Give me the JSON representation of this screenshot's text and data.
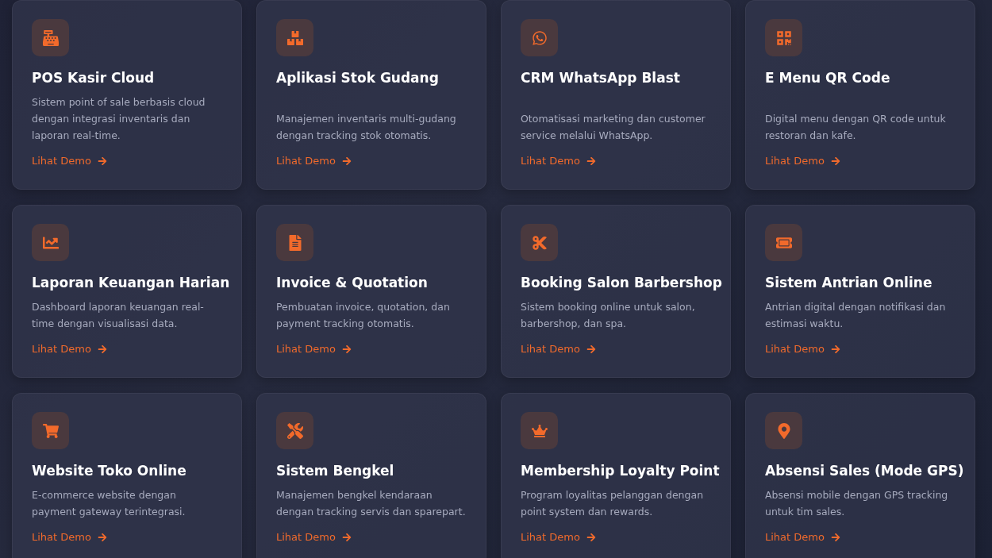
{
  "cards": [
    {
      "title": "POS Kasir Cloud",
      "description": "Sistem point of sale berbasis cloud dengan integrasi inventaris dan laporan real-time.",
      "link": "Lihat Demo"
    },
    {
      "title": "Aplikasi Stok Gudang",
      "description": "Manajemen inventaris multi-gudang dengan tracking stok otomatis.",
      "link": "Lihat Demo"
    },
    {
      "title": "CRM WhatsApp Blast",
      "description": "Otomatisasi marketing dan customer service melalui WhatsApp.",
      "link": "Lihat Demo"
    },
    {
      "title": "E Menu QR Code",
      "description": "Digital menu dengan QR code untuk restoran dan kafe.",
      "link": "Lihat Demo"
    },
    {
      "title": "Laporan Keuangan Harian",
      "description": "Dashboard laporan keuangan real-time dengan visualisasi data.",
      "link": "Lihat Demo"
    },
    {
      "title": "Invoice & Quotation",
      "description": "Pembuatan invoice, quotation, dan payment tracking otomatis.",
      "link": "Lihat Demo"
    },
    {
      "title": "Booking Salon Barbershop",
      "description": "Sistem booking online untuk salon, barbershop, dan spa.",
      "link": "Lihat Demo"
    },
    {
      "title": "Sistem Antrian Online",
      "description": "Antrian digital dengan notifikasi dan estimasi waktu.",
      "link": "Lihat Demo"
    },
    {
      "title": "Website Toko Online",
      "description": "E-commerce website dengan payment gateway terintegrasi.",
      "link": "Lihat Demo"
    },
    {
      "title": "Sistem Bengkel",
      "description": "Manajemen bengkel kendaraan dengan tracking servis dan sparepart.",
      "link": "Lihat Demo"
    },
    {
      "title": "Membership Loyalty Point",
      "description": "Program loyalitas pelanggan dengan point system dan rewards.",
      "link": "Lihat Demo"
    },
    {
      "title": "Absensi Sales (Mode GPS)",
      "description": "Absensi mobile dengan GPS tracking untuk tim sales.",
      "link": "Lihat Demo"
    }
  ]
}
